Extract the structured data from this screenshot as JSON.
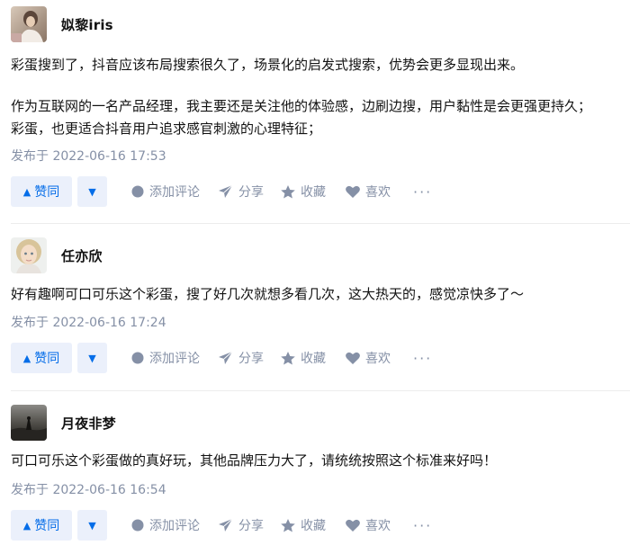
{
  "answers": [
    {
      "author": "姒黎iris",
      "avatar": "avatar-sepia-photo",
      "paragraphs": [
        "彩蛋搜到了，抖音应该布局搜索很久了，场景化的启发式搜索，优势会更多显现出来。",
        "作为互联网的一名产品经理，我主要还是关注他的体验感，边刷边搜，用户黏性是会更强更持久；",
        "彩蛋，也更适合抖音用户追求感官刺激的心理特征；"
      ],
      "time": "发布于 2022-06-16 17:53"
    },
    {
      "author": "任亦欣",
      "avatar": "avatar-child-photo",
      "paragraphs": [
        "好有趣啊可口可乐这个彩蛋，搜了好几次就想多看几次，这大热天的，感觉凉快多了～"
      ],
      "time": "发布于 2022-06-16 17:24"
    },
    {
      "author": "月夜非梦",
      "avatar": "avatar-dark-landscape",
      "paragraphs": [
        "可口可乐这个彩蛋做的真好玩，其他品牌压力大了，请统统按照这个标准来好吗！"
      ],
      "time": "发布于 2022-06-16 16:54"
    }
  ],
  "actions": {
    "vote_up": "赞同",
    "vote_up_icon": "▲",
    "vote_down_icon": "▼",
    "comment": "添加评论",
    "share": "分享",
    "favorite": "收藏",
    "like": "喜欢",
    "more": "···"
  },
  "colors": {
    "accent": "#056de8",
    "accent_bg": "#ebf0fb",
    "meta": "#8590a6"
  }
}
